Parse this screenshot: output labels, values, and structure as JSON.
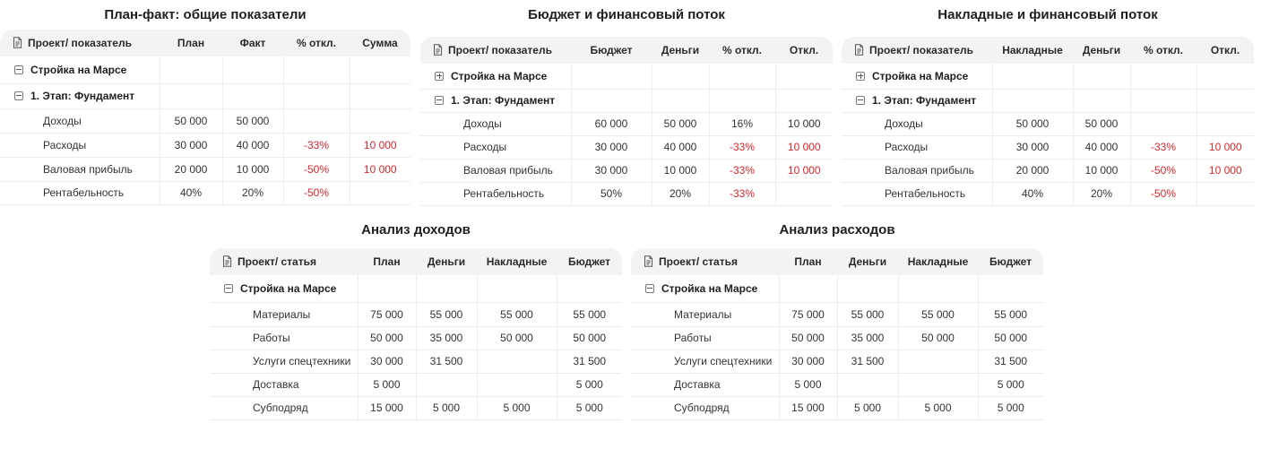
{
  "panels": [
    {
      "title": "План-факт: общие показатели",
      "columns": [
        "Проект/ показатель",
        "План",
        "Факт",
        "% откл.",
        "Сумма"
      ],
      "rows": [
        {
          "level": 0,
          "toggle": "minus",
          "cells": [
            "Стройка на Марсе",
            "",
            "",
            "",
            ""
          ]
        },
        {
          "level": 1,
          "toggle": "minus",
          "cells": [
            "1. Этап: Фундамент",
            "",
            "",
            "",
            ""
          ]
        },
        {
          "level": 2,
          "cells": [
            "Доходы",
            "50 000",
            "50 000",
            "",
            ""
          ]
        },
        {
          "level": 2,
          "cells": [
            "Расходы",
            "30 000",
            "40 000",
            "-33%",
            "10 000"
          ],
          "red": [
            3,
            4
          ]
        },
        {
          "level": 2,
          "cells": [
            "Валовая прибыль",
            "20 000",
            "10 000",
            "-50%",
            "10 000"
          ],
          "red": [
            3,
            4
          ]
        },
        {
          "level": 2,
          "cells": [
            "Рентабельность",
            "40%",
            "20%",
            "-50%",
            ""
          ],
          "red": [
            3
          ]
        }
      ]
    },
    {
      "title": "Бюджет и финансовый поток",
      "columns": [
        "Проект/ показатель",
        "Бюджет",
        "Деньги",
        "% откл.",
        "Откл."
      ],
      "rows": [
        {
          "level": 0,
          "toggle": "plus",
          "cells": [
            "Стройка на Марсе",
            "",
            "",
            "",
            ""
          ]
        },
        {
          "level": 1,
          "toggle": "minus",
          "cells": [
            "1. Этап: Фундамент",
            "",
            "",
            "",
            ""
          ]
        },
        {
          "level": 2,
          "cells": [
            "Доходы",
            "60 000",
            "50 000",
            "16%",
            "10 000"
          ]
        },
        {
          "level": 2,
          "cells": [
            "Расходы",
            "30 000",
            "40 000",
            "-33%",
            "10 000"
          ],
          "red": [
            3,
            4
          ]
        },
        {
          "level": 2,
          "cells": [
            "Валовая прибыль",
            "30 000",
            "10 000",
            "-33%",
            "10 000"
          ],
          "red": [
            3,
            4
          ]
        },
        {
          "level": 2,
          "cells": [
            "Рентабельность",
            "50%",
            "20%",
            "-33%",
            ""
          ],
          "red": [
            3
          ]
        }
      ]
    },
    {
      "title": "Накладные и финансовый поток",
      "columns": [
        "Проект/ показатель",
        "Накладные",
        "Деньги",
        "% откл.",
        "Откл."
      ],
      "rows": [
        {
          "level": 0,
          "toggle": "plus",
          "cells": [
            "Стройка на Марсе",
            "",
            "",
            "",
            ""
          ]
        },
        {
          "level": 1,
          "toggle": "minus",
          "cells": [
            "1. Этап: Фундамент",
            "",
            "",
            "",
            ""
          ]
        },
        {
          "level": 2,
          "cells": [
            "Доходы",
            "50 000",
            "50 000",
            "",
            ""
          ]
        },
        {
          "level": 2,
          "cells": [
            "Расходы",
            "30 000",
            "40 000",
            "-33%",
            "10 000"
          ],
          "red": [
            3,
            4
          ]
        },
        {
          "level": 2,
          "cells": [
            "Валовая прибыль",
            "20 000",
            "10 000",
            "-50%",
            "10 000"
          ],
          "red": [
            3,
            4
          ]
        },
        {
          "level": 2,
          "cells": [
            "Рентабельность",
            "40%",
            "20%",
            "-50%",
            ""
          ],
          "red": [
            3
          ]
        }
      ]
    },
    {
      "title": "Анализ доходов",
      "columns": [
        "Проект/ статья",
        "План",
        "Деньги",
        "Накладные",
        "Бюджет"
      ],
      "rows": [
        {
          "level": 0,
          "toggle": "minus",
          "cells": [
            "Стройка на Марсе",
            "",
            "",
            "",
            ""
          ]
        },
        {
          "level": 2,
          "cells": [
            "Материалы",
            "75 000",
            "55 000",
            "55 000",
            "55 000"
          ]
        },
        {
          "level": 2,
          "cells": [
            "Работы",
            "50 000",
            "35 000",
            "50 000",
            "50 000"
          ]
        },
        {
          "level": 2,
          "cells": [
            "Услуги спецтехники",
            "30 000",
            "31 500",
            "",
            "31 500"
          ]
        },
        {
          "level": 2,
          "cells": [
            "Доставка",
            "5 000",
            "",
            "",
            "5 000"
          ]
        },
        {
          "level": 2,
          "cells": [
            "Субподряд",
            "15 000",
            "5 000",
            "5 000",
            "5 000"
          ]
        }
      ]
    },
    {
      "title": "Анализ расходов",
      "columns": [
        "Проект/ статья",
        "План",
        "Деньги",
        "Накладные",
        "Бюджет"
      ],
      "rows": [
        {
          "level": 0,
          "toggle": "minus",
          "cells": [
            "Стройка на Марсе",
            "",
            "",
            "",
            ""
          ]
        },
        {
          "level": 2,
          "cells": [
            "Материалы",
            "75 000",
            "55 000",
            "55 000",
            "55 000"
          ]
        },
        {
          "level": 2,
          "cells": [
            "Работы",
            "50 000",
            "35 000",
            "50 000",
            "50 000"
          ]
        },
        {
          "level": 2,
          "cells": [
            "Услуги спецтехники",
            "30 000",
            "31 500",
            "",
            "31 500"
          ]
        },
        {
          "level": 2,
          "cells": [
            "Доставка",
            "5 000",
            "",
            "",
            "5 000"
          ]
        },
        {
          "level": 2,
          "cells": [
            "Субподряд",
            "15 000",
            "5 000",
            "5 000",
            "5 000"
          ]
        }
      ]
    }
  ],
  "colors": {
    "negative": "#e0252b",
    "header_bg": "#f3f3f3",
    "grid": "#ececec"
  },
  "icons": {
    "header": "document-icon",
    "expand": "plus-square-icon",
    "collapse": "minus-square-icon"
  }
}
